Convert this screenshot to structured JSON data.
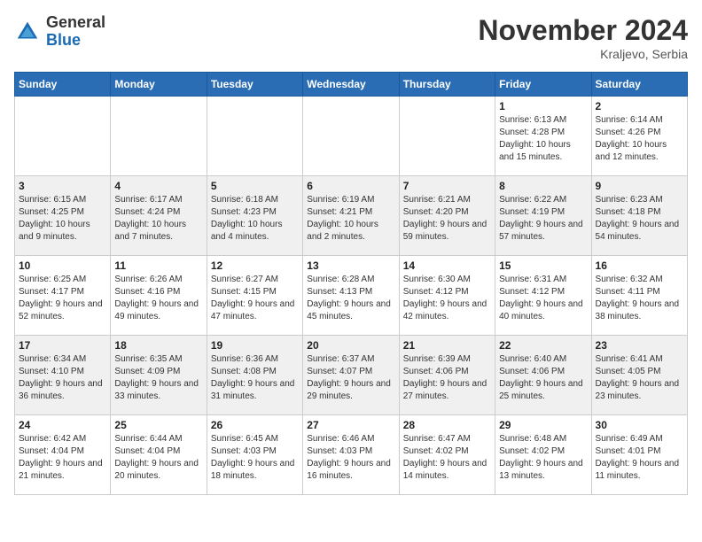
{
  "header": {
    "logo_general": "General",
    "logo_blue": "Blue",
    "month_title": "November 2024",
    "location": "Kraljevo, Serbia"
  },
  "days_of_week": [
    "Sunday",
    "Monday",
    "Tuesday",
    "Wednesday",
    "Thursday",
    "Friday",
    "Saturday"
  ],
  "weeks": [
    [
      {
        "day": "",
        "info": ""
      },
      {
        "day": "",
        "info": ""
      },
      {
        "day": "",
        "info": ""
      },
      {
        "day": "",
        "info": ""
      },
      {
        "day": "",
        "info": ""
      },
      {
        "day": "1",
        "info": "Sunrise: 6:13 AM\nSunset: 4:28 PM\nDaylight: 10 hours and 15 minutes."
      },
      {
        "day": "2",
        "info": "Sunrise: 6:14 AM\nSunset: 4:26 PM\nDaylight: 10 hours and 12 minutes."
      }
    ],
    [
      {
        "day": "3",
        "info": "Sunrise: 6:15 AM\nSunset: 4:25 PM\nDaylight: 10 hours and 9 minutes."
      },
      {
        "day": "4",
        "info": "Sunrise: 6:17 AM\nSunset: 4:24 PM\nDaylight: 10 hours and 7 minutes."
      },
      {
        "day": "5",
        "info": "Sunrise: 6:18 AM\nSunset: 4:23 PM\nDaylight: 10 hours and 4 minutes."
      },
      {
        "day": "6",
        "info": "Sunrise: 6:19 AM\nSunset: 4:21 PM\nDaylight: 10 hours and 2 minutes."
      },
      {
        "day": "7",
        "info": "Sunrise: 6:21 AM\nSunset: 4:20 PM\nDaylight: 9 hours and 59 minutes."
      },
      {
        "day": "8",
        "info": "Sunrise: 6:22 AM\nSunset: 4:19 PM\nDaylight: 9 hours and 57 minutes."
      },
      {
        "day": "9",
        "info": "Sunrise: 6:23 AM\nSunset: 4:18 PM\nDaylight: 9 hours and 54 minutes."
      }
    ],
    [
      {
        "day": "10",
        "info": "Sunrise: 6:25 AM\nSunset: 4:17 PM\nDaylight: 9 hours and 52 minutes."
      },
      {
        "day": "11",
        "info": "Sunrise: 6:26 AM\nSunset: 4:16 PM\nDaylight: 9 hours and 49 minutes."
      },
      {
        "day": "12",
        "info": "Sunrise: 6:27 AM\nSunset: 4:15 PM\nDaylight: 9 hours and 47 minutes."
      },
      {
        "day": "13",
        "info": "Sunrise: 6:28 AM\nSunset: 4:13 PM\nDaylight: 9 hours and 45 minutes."
      },
      {
        "day": "14",
        "info": "Sunrise: 6:30 AM\nSunset: 4:12 PM\nDaylight: 9 hours and 42 minutes."
      },
      {
        "day": "15",
        "info": "Sunrise: 6:31 AM\nSunset: 4:12 PM\nDaylight: 9 hours and 40 minutes."
      },
      {
        "day": "16",
        "info": "Sunrise: 6:32 AM\nSunset: 4:11 PM\nDaylight: 9 hours and 38 minutes."
      }
    ],
    [
      {
        "day": "17",
        "info": "Sunrise: 6:34 AM\nSunset: 4:10 PM\nDaylight: 9 hours and 36 minutes."
      },
      {
        "day": "18",
        "info": "Sunrise: 6:35 AM\nSunset: 4:09 PM\nDaylight: 9 hours and 33 minutes."
      },
      {
        "day": "19",
        "info": "Sunrise: 6:36 AM\nSunset: 4:08 PM\nDaylight: 9 hours and 31 minutes."
      },
      {
        "day": "20",
        "info": "Sunrise: 6:37 AM\nSunset: 4:07 PM\nDaylight: 9 hours and 29 minutes."
      },
      {
        "day": "21",
        "info": "Sunrise: 6:39 AM\nSunset: 4:06 PM\nDaylight: 9 hours and 27 minutes."
      },
      {
        "day": "22",
        "info": "Sunrise: 6:40 AM\nSunset: 4:06 PM\nDaylight: 9 hours and 25 minutes."
      },
      {
        "day": "23",
        "info": "Sunrise: 6:41 AM\nSunset: 4:05 PM\nDaylight: 9 hours and 23 minutes."
      }
    ],
    [
      {
        "day": "24",
        "info": "Sunrise: 6:42 AM\nSunset: 4:04 PM\nDaylight: 9 hours and 21 minutes."
      },
      {
        "day": "25",
        "info": "Sunrise: 6:44 AM\nSunset: 4:04 PM\nDaylight: 9 hours and 20 minutes."
      },
      {
        "day": "26",
        "info": "Sunrise: 6:45 AM\nSunset: 4:03 PM\nDaylight: 9 hours and 18 minutes."
      },
      {
        "day": "27",
        "info": "Sunrise: 6:46 AM\nSunset: 4:03 PM\nDaylight: 9 hours and 16 minutes."
      },
      {
        "day": "28",
        "info": "Sunrise: 6:47 AM\nSunset: 4:02 PM\nDaylight: 9 hours and 14 minutes."
      },
      {
        "day": "29",
        "info": "Sunrise: 6:48 AM\nSunset: 4:02 PM\nDaylight: 9 hours and 13 minutes."
      },
      {
        "day": "30",
        "info": "Sunrise: 6:49 AM\nSunset: 4:01 PM\nDaylight: 9 hours and 11 minutes."
      }
    ]
  ]
}
